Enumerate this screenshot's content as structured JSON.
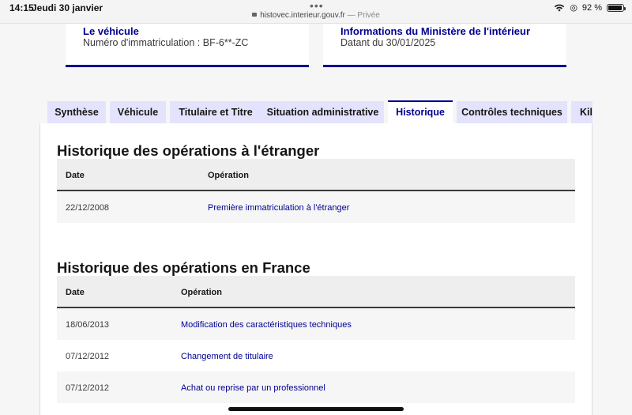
{
  "status_bar": {
    "time": "14:15",
    "date": "Jeudi 30 janvier",
    "url": "histovec.interieur.gouv.fr",
    "url_suffix": " — Privée",
    "battery": "92 %",
    "battery_level": 0.92,
    "icons": [
      "wifi-icon",
      "lock-icon",
      "battery-icon"
    ]
  },
  "cards": {
    "vehicle": {
      "title": "Le véhicule",
      "subtitle": "Numéro d'immatriculation : BF-6**-ZC"
    },
    "info": {
      "title": "Informations du Ministère de l'intérieur",
      "subtitle": "Datant du 30/01/2025"
    }
  },
  "tabs": [
    {
      "label": "Synthèse",
      "active": false
    },
    {
      "label": "Véhicule",
      "active": false
    },
    {
      "label": "Titulaire et Titre",
      "active": false
    },
    {
      "label": "Situation administrative",
      "active": false
    },
    {
      "label": "Historique",
      "active": true
    },
    {
      "label": "Contrôles techniques",
      "active": false
    },
    {
      "label": "Kilo",
      "active": false
    }
  ],
  "foreign": {
    "title": "Historique des opérations à l'étranger",
    "headers": {
      "date": "Date",
      "operation": "Opération"
    },
    "rows": [
      {
        "date": "22/12/2008",
        "operation": "Première immatriculation à l'étranger"
      }
    ]
  },
  "france": {
    "title": "Historique des opérations en France",
    "headers": {
      "date": "Date",
      "operation": "Opération"
    },
    "rows": [
      {
        "date": "18/06/2013",
        "operation": "Modification des caractéristiques techniques"
      },
      {
        "date": "07/12/2012",
        "operation": "Changement de titulaire"
      },
      {
        "date": "07/12/2012",
        "operation": "Achat ou reprise par un professionnel"
      }
    ]
  },
  "colors": {
    "accent": "#000091",
    "tab_bg": "#e3e3fd",
    "row_alt": "#f6f6f6",
    "header_bg": "#eeeeee"
  }
}
